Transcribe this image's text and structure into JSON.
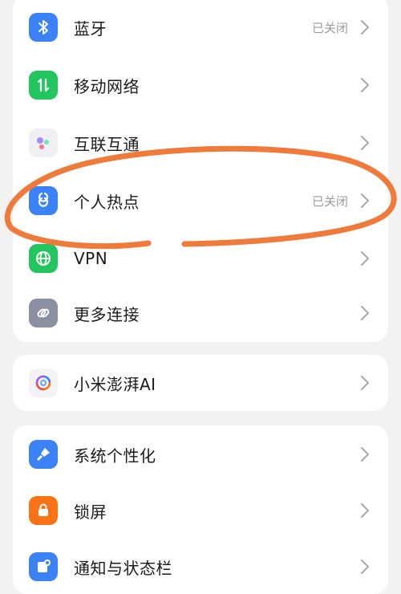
{
  "colors": {
    "page_bg": "#f2f2f2",
    "card_bg": "#ffffff",
    "annotation": "#ef7a3a"
  },
  "status_text": {
    "bluetooth": "已关闭",
    "hotspot": "已关闭"
  },
  "groups": [
    {
      "items": [
        {
          "label": "蓝牙",
          "icon": "bluetooth-icon",
          "icon_color": "#3b82f6"
        },
        {
          "label": "移动网络",
          "icon": "mobile-data-icon",
          "icon_color": "#22c55e"
        },
        {
          "label": "互联互通",
          "icon": "interconnect-icon",
          "icon_color": "#eef0f4"
        },
        {
          "label": "个人热点",
          "icon": "hotspot-icon",
          "icon_color": "#3b82f6"
        },
        {
          "label": "VPN",
          "icon": "vpn-globe-icon",
          "icon_color": "#22c55e"
        },
        {
          "label": "更多连接",
          "icon": "link-icon",
          "icon_color": "#8a90a0"
        }
      ]
    },
    {
      "items": [
        {
          "label": "小米澎湃AI",
          "icon": "hyperos-ai-icon",
          "icon_color": "#f3f3f5"
        }
      ]
    },
    {
      "items": [
        {
          "label": "系统个性化",
          "icon": "personalization-brush-icon",
          "icon_color": "#3b82f6"
        },
        {
          "label": "锁屏",
          "icon": "lock-icon",
          "icon_color": "#f97316"
        },
        {
          "label": "通知与状态栏",
          "icon": "notification-icon",
          "icon_color": "#3b82f6"
        }
      ]
    }
  ]
}
